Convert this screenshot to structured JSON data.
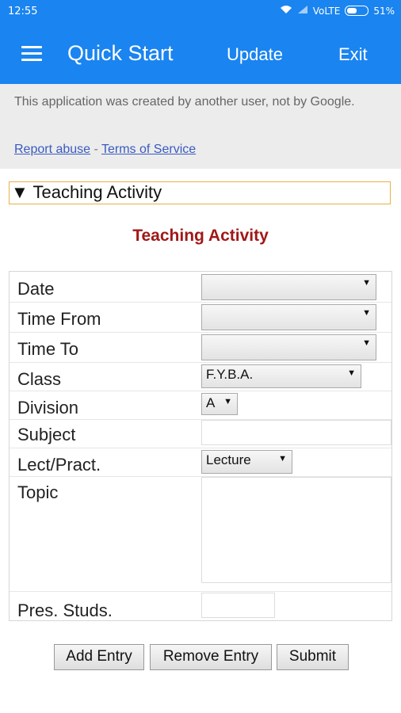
{
  "status_bar": {
    "time": "12:55",
    "network": "VoLTE",
    "battery": "51%"
  },
  "app_bar": {
    "title": "Quick Start",
    "update_label": "Update",
    "exit_label": "Exit"
  },
  "banner": {
    "notice": "This application was created by another user, not by Google.",
    "report_abuse": "Report abuse",
    "separator": "-",
    "terms": "Terms of Service"
  },
  "section": {
    "toggle_label": "▼ Teaching Activity",
    "heading": "Teaching Activity"
  },
  "form": {
    "date_label": "Date",
    "date_value": "",
    "time_from_label": "Time From",
    "time_from_value": "",
    "time_to_label": "Time To",
    "time_to_value": "",
    "class_label": "Class",
    "class_value": "F.Y.B.A.",
    "division_label": "Division",
    "division_value": "A",
    "subject_label": "Subject",
    "subject_value": "",
    "lect_pract_label": "Lect/Pract.",
    "lect_pract_value": "Lecture",
    "topic_label": "Topic",
    "topic_value": "",
    "pres_studs_label": "Pres. Studs.",
    "pres_studs_value": ""
  },
  "buttons": {
    "add_entry": "Add Entry",
    "remove_entry": "Remove Entry",
    "submit": "Submit"
  },
  "colors": {
    "app_bar": "#1a84f0",
    "heading": "#a01818",
    "toggle_border": "#e8b04a"
  }
}
